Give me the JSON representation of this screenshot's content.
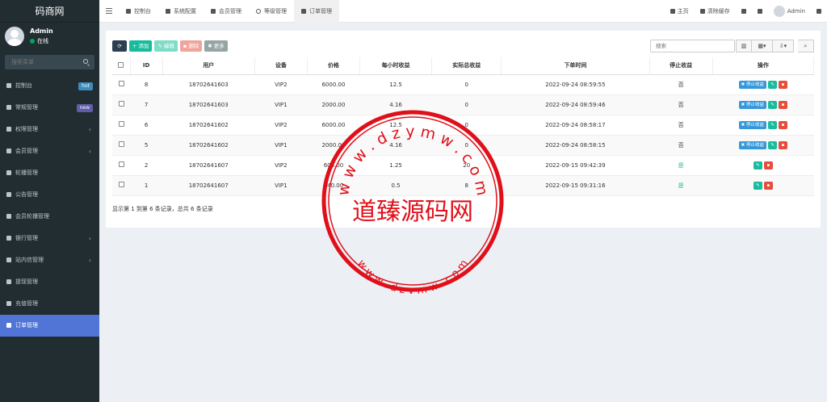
{
  "brand": "码商网",
  "user": {
    "name": "Admin",
    "status": "在线"
  },
  "sidebar_search_placeholder": "搜索菜单",
  "menu": [
    {
      "label": "控制台",
      "badge": "hot",
      "icon": "dashboard-icon"
    },
    {
      "label": "常规管理",
      "badge": "new",
      "icon": "cogs-icon"
    },
    {
      "label": "权限管理",
      "chevron": true,
      "icon": "group-icon"
    },
    {
      "label": "会员管理",
      "chevron": true,
      "icon": "user-circle-icon"
    },
    {
      "label": "轮播管理",
      "icon": "list-icon"
    },
    {
      "label": "公告管理",
      "icon": "list-icon"
    },
    {
      "label": "会员轮播管理",
      "icon": "list-icon"
    },
    {
      "label": "银行管理",
      "chevron": true,
      "icon": "list-icon"
    },
    {
      "label": "站内信管理",
      "chevron": true,
      "icon": "list-icon"
    },
    {
      "label": "提现管理",
      "icon": "list-icon"
    },
    {
      "label": "充值管理",
      "icon": "list-icon"
    },
    {
      "label": "订单管理",
      "active": true,
      "icon": "list-icon"
    }
  ],
  "tabs": [
    {
      "label": "控制台"
    },
    {
      "label": "系统配置"
    },
    {
      "label": "会员管理"
    },
    {
      "label": "等级管理"
    },
    {
      "label": "订单管理",
      "active": true
    }
  ],
  "topright": {
    "home": "主页",
    "clear_cache": "清除缓存",
    "admin": "Admin"
  },
  "toolbar": {
    "add": "添加",
    "edit": "编辑",
    "delete": "删除",
    "more": "更多"
  },
  "search_placeholder": "搜索",
  "table": {
    "headers": [
      "ID",
      "用户",
      "设备",
      "价格",
      "每小时收益",
      "实际总收益",
      "下单时间",
      "停止收益",
      "操作"
    ],
    "rows": [
      {
        "id": "8",
        "user": "18702641603",
        "device": "VIP2",
        "price": "6000.00",
        "hourly": "12.5",
        "total": "0",
        "time": "2022-09-24 08:59:55",
        "stopped": "否",
        "can_stop": true
      },
      {
        "id": "7",
        "user": "18702641603",
        "device": "VIP1",
        "price": "2000.00",
        "hourly": "4.16",
        "total": "0",
        "time": "2022-09-24 08:59:46",
        "stopped": "否",
        "can_stop": true
      },
      {
        "id": "6",
        "user": "18702641602",
        "device": "VIP2",
        "price": "6000.00",
        "hourly": "12.5",
        "total": "0",
        "time": "2022-09-24 08:58:17",
        "stopped": "否",
        "can_stop": true
      },
      {
        "id": "5",
        "user": "18702641602",
        "device": "VIP1",
        "price": "2000.00",
        "hourly": "4.16",
        "total": "0",
        "time": "2022-09-24 08:58:15",
        "stopped": "否",
        "can_stop": true
      },
      {
        "id": "2",
        "user": "18702641607",
        "device": "VIP2",
        "price": "600.00",
        "hourly": "1.25",
        "total": "20",
        "time": "2022-09-15 09:42:39",
        "stopped": "是",
        "can_stop": false
      },
      {
        "id": "1",
        "user": "18702641607",
        "device": "VIP1",
        "price": "240.00",
        "hourly": "0.5",
        "total": "8",
        "time": "2022-09-15 09:31:16",
        "stopped": "是",
        "can_stop": false
      }
    ]
  },
  "stop_btn_label": "停止收益",
  "footer": "显示第 1 到第 6 条记录，总共 6 条记录",
  "watermark": {
    "center": "道臻源码网",
    "ring": "w w w . d z y m w . c o m"
  },
  "colors": {
    "sidebar": "#222d32",
    "active_menu": "#5175d6",
    "add": "#18bc9c",
    "stop": "#3498db",
    "delete": "#e74c3c",
    "watermark": "#e0101a"
  }
}
